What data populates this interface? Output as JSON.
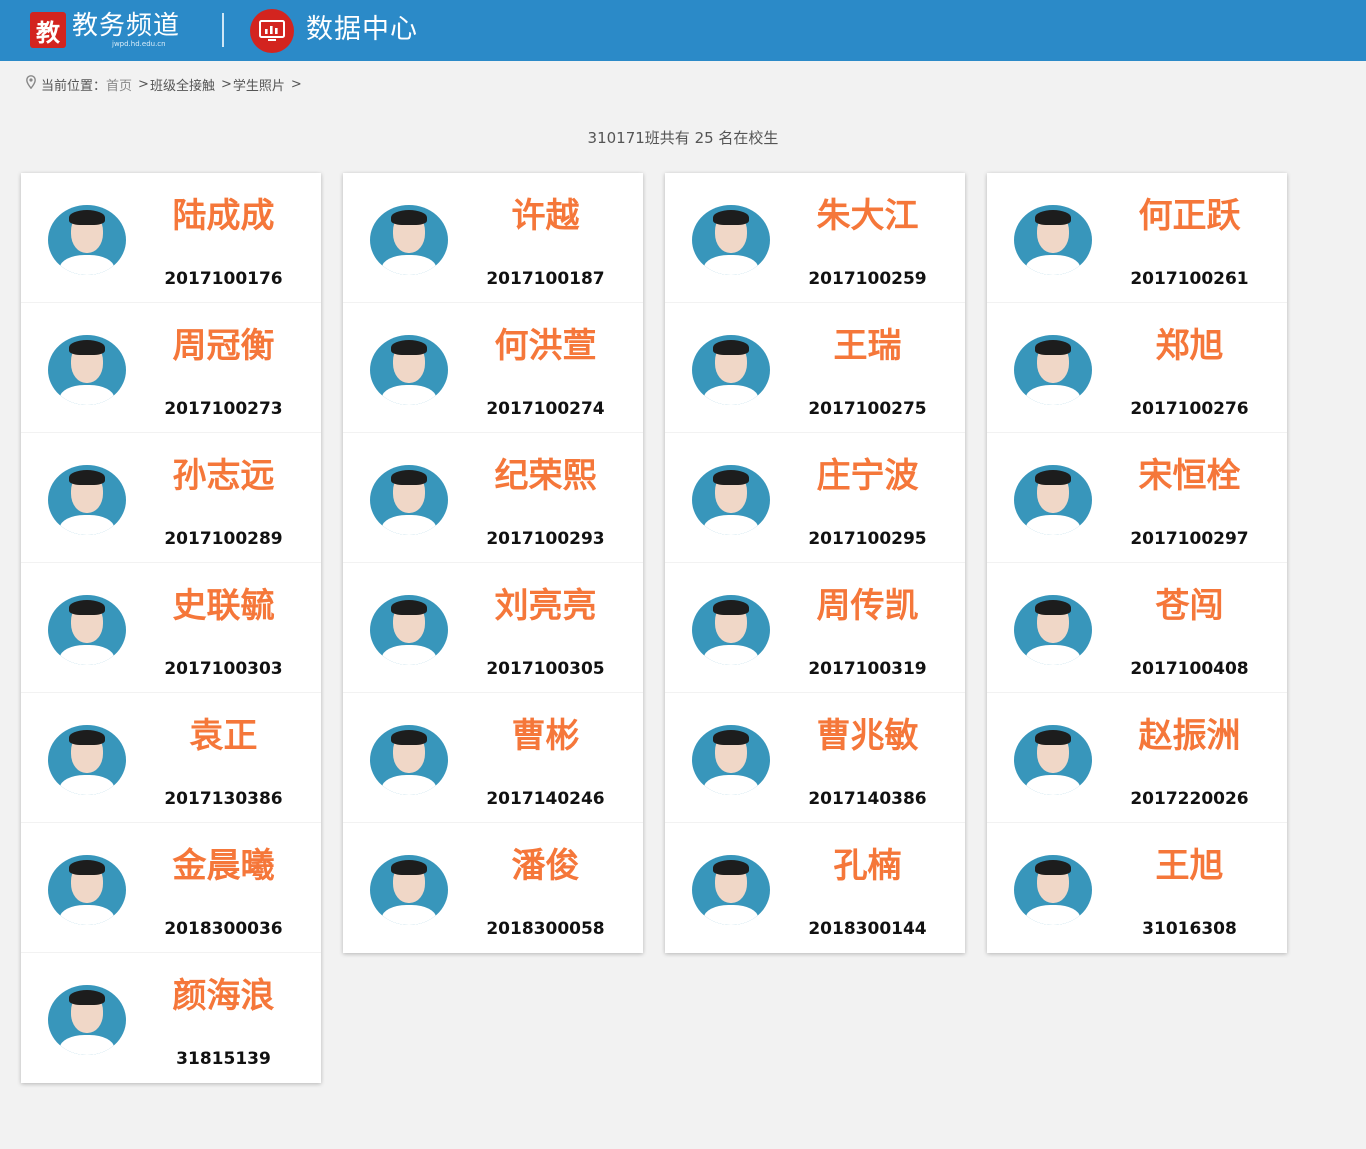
{
  "header": {
    "brand_logo_char": "教",
    "brand_title": "教务频道",
    "brand_sub": "jwpd.hd.edu.cn",
    "data_center_title": "数据中心"
  },
  "breadcrumb": {
    "pin_icon": "location-pin-icon",
    "label": "当前位置：",
    "items": [
      "首页",
      "班级全接触",
      "学生照片"
    ],
    "trailing": ">"
  },
  "summary": "310171班共有 25 名在校生",
  "colors": {
    "header_bg": "#2b8ac8",
    "brand_red": "#d3241f",
    "name_orange": "#f5773a",
    "avatar_blue": "#3896bb"
  },
  "columns": [
    [
      {
        "name": "陆成成",
        "id": "2017100176"
      },
      {
        "name": "周冠衡",
        "id": "2017100273"
      },
      {
        "name": "孙志远",
        "id": "2017100289"
      },
      {
        "name": "史联毓",
        "id": "2017100303"
      },
      {
        "name": "袁正",
        "id": "2017130386"
      },
      {
        "name": "金晨曦",
        "id": "2018300036"
      },
      {
        "name": "颜海浪",
        "id": "31815139"
      }
    ],
    [
      {
        "name": "许越",
        "id": "2017100187"
      },
      {
        "name": "何洪萱",
        "id": "2017100274"
      },
      {
        "name": "纪荣熙",
        "id": "2017100293"
      },
      {
        "name": "刘亮亮",
        "id": "2017100305"
      },
      {
        "name": "曹彬",
        "id": "2017140246"
      },
      {
        "name": "潘俊",
        "id": "2018300058"
      }
    ],
    [
      {
        "name": "朱大江",
        "id": "2017100259"
      },
      {
        "name": "王瑞",
        "id": "2017100275"
      },
      {
        "name": "庄宁波",
        "id": "2017100295"
      },
      {
        "name": "周传凯",
        "id": "2017100319"
      },
      {
        "name": "曹兆敏",
        "id": "2017140386"
      },
      {
        "name": "孔楠",
        "id": "2018300144"
      }
    ],
    [
      {
        "name": "何正跃",
        "id": "2017100261"
      },
      {
        "name": "郑旭",
        "id": "2017100276"
      },
      {
        "name": "宋恒栓",
        "id": "2017100297"
      },
      {
        "name": "苍闯",
        "id": "2017100408"
      },
      {
        "name": "赵振洲",
        "id": "2017220026"
      },
      {
        "name": "王旭",
        "id": "31016308"
      }
    ]
  ]
}
